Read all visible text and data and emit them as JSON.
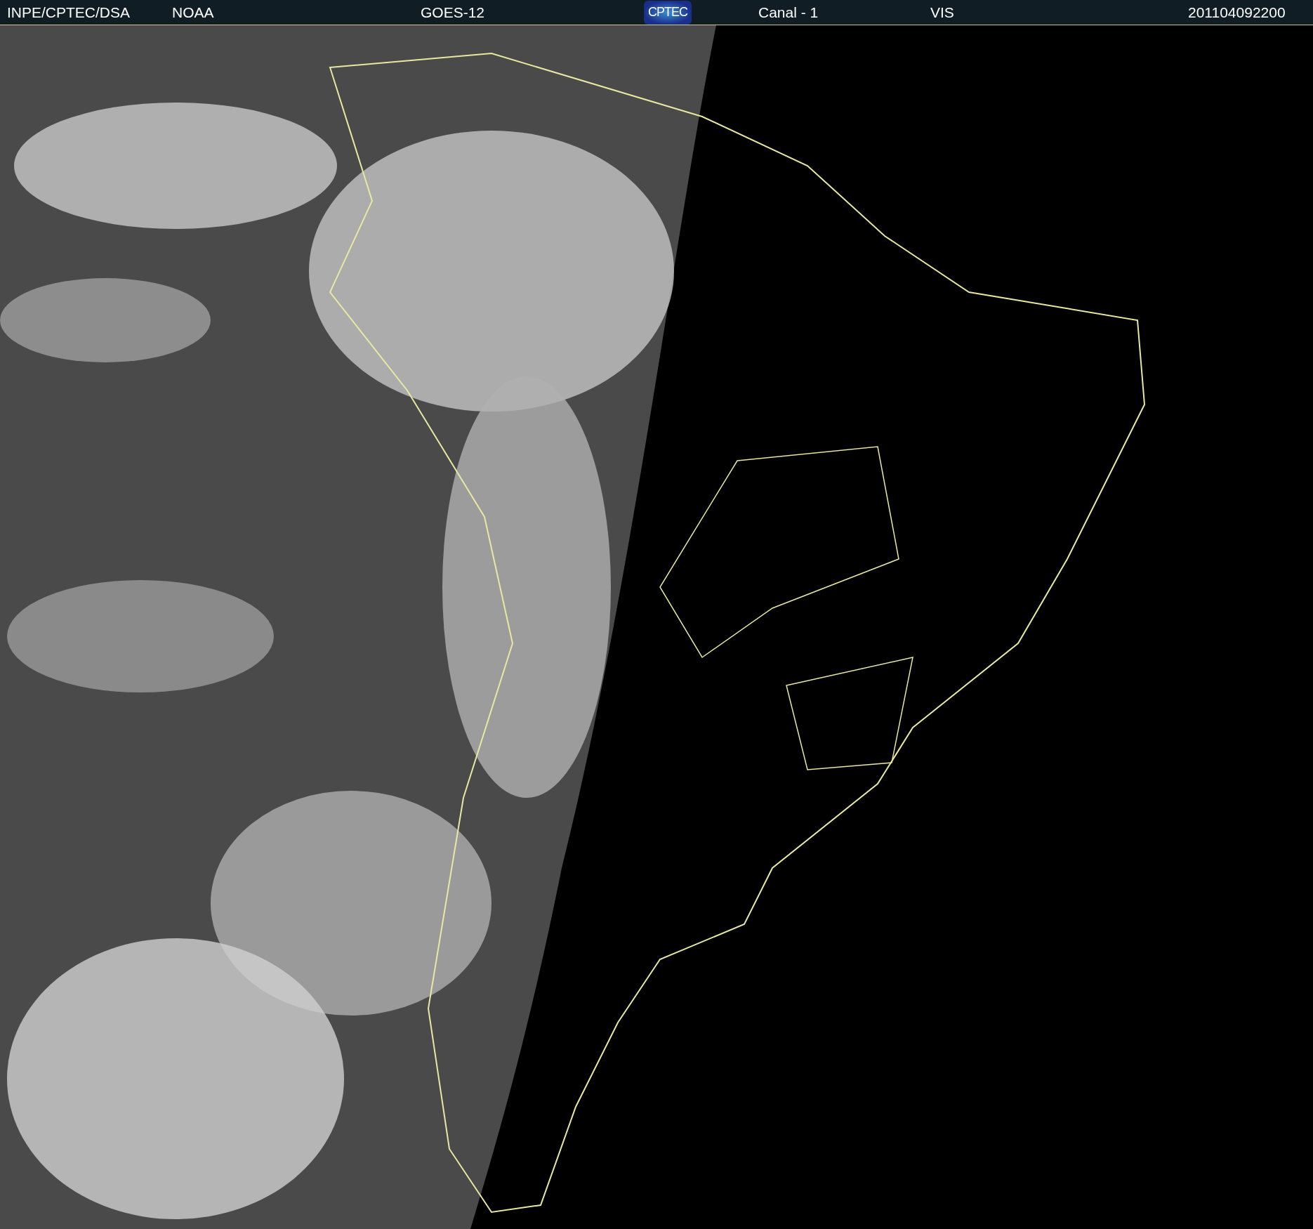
{
  "header": {
    "source": "INPE/CPTEC/DSA",
    "agency": "NOAA",
    "satellite": "GOES-12",
    "logo": "CPTEC",
    "channel": "Canal - 1",
    "band": "VIS",
    "timestamp": "201104092200"
  }
}
